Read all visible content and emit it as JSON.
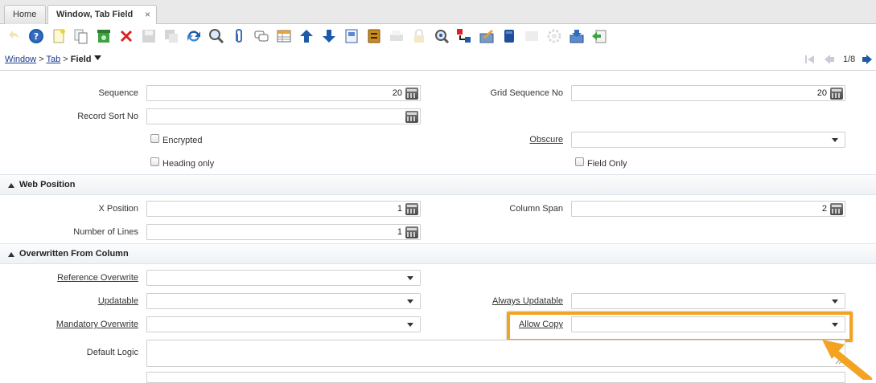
{
  "tabs": [
    {
      "label": "Home"
    },
    {
      "label": "Window, Tab Field",
      "close": "×"
    }
  ],
  "toolbar": {
    "buttons": [
      "undo-icon",
      "help-icon",
      "new-record-icon",
      "copy-record-icon",
      "delete-selected-icon",
      "delete-record-icon",
      "save-icon",
      "save-and-new-icon",
      "refresh-icon",
      "find-icon",
      "attachment-icon",
      "chat-icon",
      "grid-toggle-icon",
      "previous-record-icon",
      "next-record-icon",
      "report-icon",
      "archive-icon",
      "print-icon",
      "lock-icon",
      "zoom-across-icon",
      "active-workflows-icon",
      "requests-icon",
      "product-info-icon",
      "process-icon",
      "customize-icon",
      "export-icon",
      "import-icon"
    ]
  },
  "breadcrumb": {
    "window": "Window",
    "sep1": ">",
    "tab": "Tab",
    "sep2": ">",
    "current": "Field",
    "pager": "1/8"
  },
  "form": {
    "sequence": {
      "label": "Sequence",
      "value": "20"
    },
    "grid_sequence": {
      "label": "Grid Sequence No",
      "value": "20"
    },
    "record_sort": {
      "label": "Record Sort No",
      "value": ""
    },
    "encrypted": {
      "label": "Encrypted"
    },
    "obscure": {
      "label": "Obscure",
      "value": ""
    },
    "heading_only": {
      "label": "Heading only"
    },
    "field_only": {
      "label": "Field Only"
    }
  },
  "web_position": {
    "title": "Web Position",
    "x_position": {
      "label": "X Position",
      "value": "1"
    },
    "column_span": {
      "label": "Column Span",
      "value": "2"
    },
    "lines": {
      "label": "Number of Lines",
      "value": "1"
    }
  },
  "overwritten": {
    "title": "Overwritten From Column",
    "reference": {
      "label": "Reference Overwrite",
      "value": ""
    },
    "updatable": {
      "label": "Updatable",
      "value": ""
    },
    "always_updatable": {
      "label": "Always Updatable",
      "value": ""
    },
    "mandatory": {
      "label": "Mandatory Overwrite",
      "value": ""
    },
    "allow_copy": {
      "label": "Allow Copy",
      "value": ""
    },
    "default_logic": {
      "label": "Default Logic",
      "value": ""
    }
  },
  "colors": {
    "highlight": "#f3a321",
    "link": "#1a3a8c",
    "nav_arrow": "#1f5aa8"
  }
}
